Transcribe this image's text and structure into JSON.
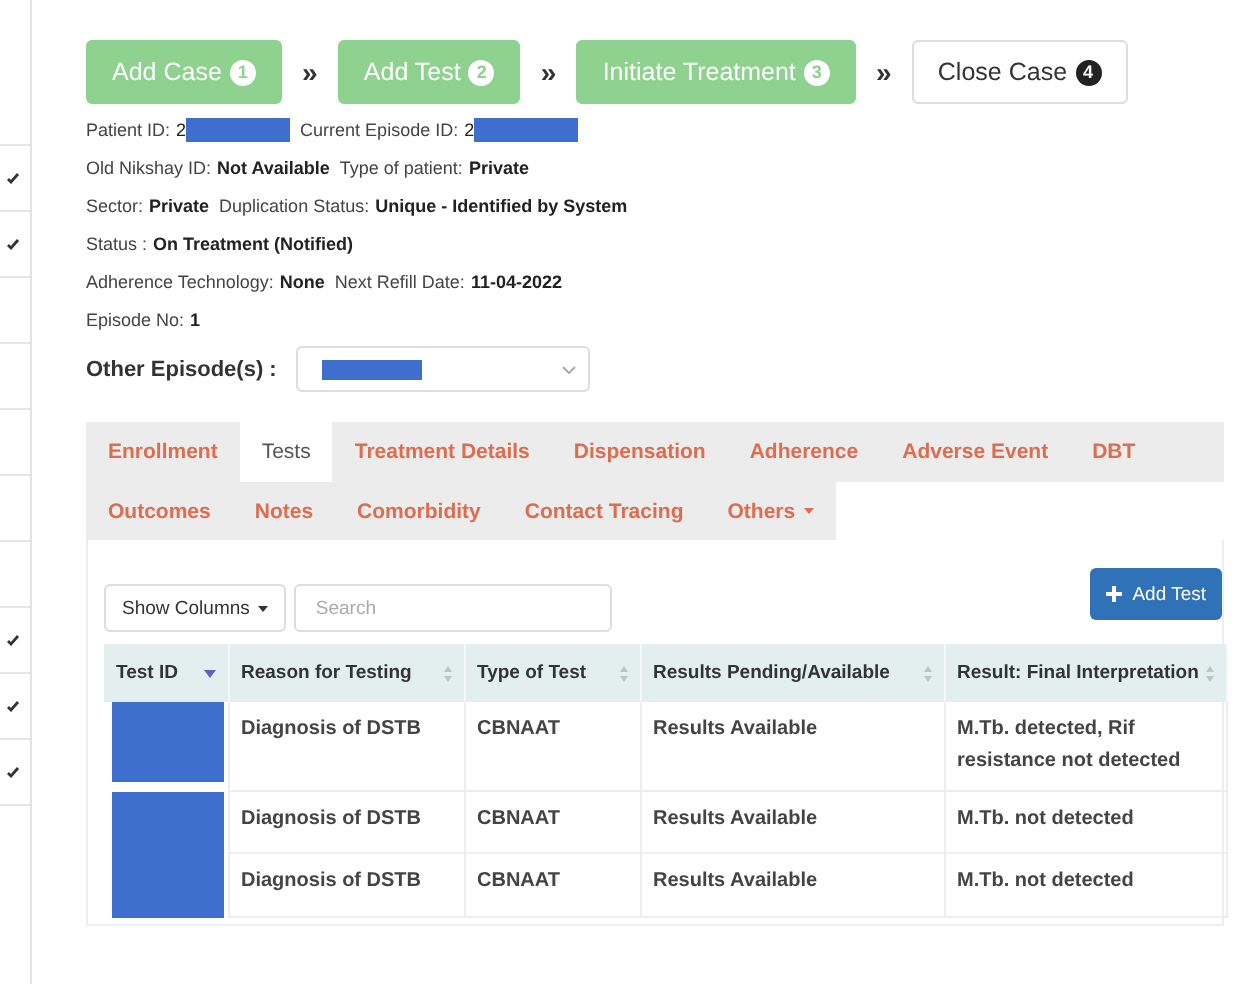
{
  "sidebar": {
    "rows": [
      {
        "checked": false
      },
      {
        "checked": true
      },
      {
        "checked": true
      },
      {
        "checked": false
      },
      {
        "checked": false
      },
      {
        "checked": false
      },
      {
        "checked": false
      },
      {
        "checked": false
      },
      {
        "checked": true
      },
      {
        "checked": true
      },
      {
        "checked": true
      }
    ]
  },
  "steps": [
    {
      "label": "Add Case",
      "number": "1",
      "done": true
    },
    {
      "label": "Add Test",
      "number": "2",
      "done": true
    },
    {
      "label": "Initiate Treatment",
      "number": "3",
      "done": true
    },
    {
      "label": "Close Case",
      "number": "4",
      "done": false
    }
  ],
  "step_separator": "»",
  "patient_info": [
    [
      {
        "label": "Patient ID:",
        "value": "2",
        "redacted": true
      },
      {
        "label": "Current Episode ID:",
        "value": "2",
        "redacted": true
      }
    ],
    [
      {
        "label": "Old Nikshay ID:",
        "value": "Not Available",
        "redacted": false
      },
      {
        "label": "Type of patient:",
        "value": "Private",
        "redacted": false
      }
    ],
    [
      {
        "label": "Sector:",
        "value": "Private",
        "redacted": false
      },
      {
        "label": "Duplication Status:",
        "value": "Unique - Identified by System",
        "redacted": false
      }
    ],
    [
      {
        "label": "Status :",
        "value": "On Treatment (Notified)",
        "redacted": false
      }
    ],
    [
      {
        "label": "Adherence Technology:",
        "value": "None",
        "redacted": false
      },
      {
        "label": "Next Refill Date:",
        "value": "11-04-2022",
        "redacted": false
      }
    ],
    [
      {
        "label": "Episode No:",
        "value": "1",
        "redacted": false
      }
    ]
  ],
  "other_episodes": {
    "label": "Other Episode(s) :",
    "redacted": true
  },
  "tabs": [
    [
      {
        "label": "Enrollment",
        "selected": false
      },
      {
        "label": "Tests",
        "selected": true
      },
      {
        "label": "Treatment Details",
        "selected": false
      },
      {
        "label": "Dispensation",
        "selected": false
      },
      {
        "label": "Adherence",
        "selected": false
      },
      {
        "label": "Adverse Event",
        "selected": false
      },
      {
        "label": "DBT",
        "selected": false
      }
    ],
    [
      {
        "label": "Outcomes",
        "selected": false
      },
      {
        "label": "Notes",
        "selected": false
      },
      {
        "label": "Comorbidity",
        "selected": false
      },
      {
        "label": "Contact Tracing",
        "selected": false
      },
      {
        "label": "Others",
        "selected": false,
        "dropdown": true
      }
    ]
  ],
  "toolbar": {
    "show_columns": "Show Columns",
    "search_placeholder": "Search",
    "add_button": "Add Test"
  },
  "table": {
    "columns": [
      {
        "label": "Test ID",
        "sorted": true
      },
      {
        "label": "Reason for Testing",
        "sorted": false
      },
      {
        "label": "Type of Test",
        "sorted": false
      },
      {
        "label": "Results Pending/Available",
        "sorted": false
      },
      {
        "label": "Result: Final Interpretation",
        "sorted": false
      }
    ],
    "rows": [
      {
        "test_id_redacted": true,
        "cells": [
          "",
          "Diagnosis of DSTB",
          "CBNAAT",
          "Results Available",
          "M.Tb. detected, Rif resistance not detected"
        ]
      },
      {
        "test_id_redacted": true,
        "cells": [
          "",
          "Diagnosis of DSTB",
          "CBNAAT",
          "Results Available",
          "M.Tb. not detected"
        ]
      },
      {
        "test_id_redacted": true,
        "cells": [
          "",
          "Diagnosis of DSTB",
          "CBNAAT",
          "Results Available",
          "M.Tb. not detected"
        ]
      }
    ]
  }
}
